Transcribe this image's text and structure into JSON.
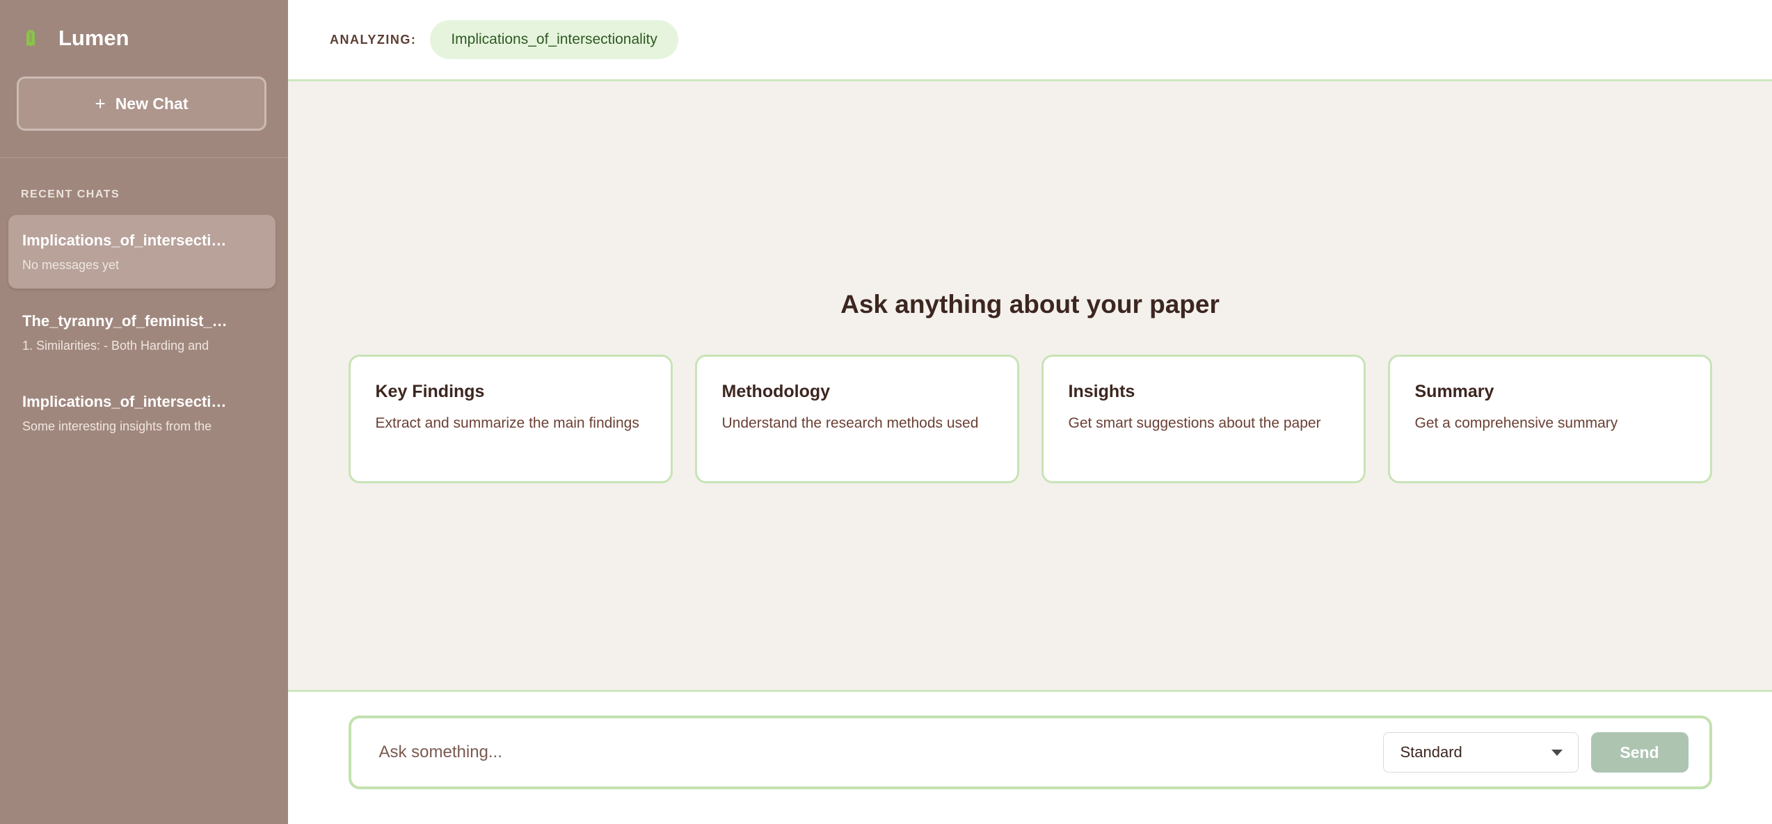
{
  "app": {
    "name": "Lumen",
    "icon": "lumen-logo-icon",
    "accent_color": "#8bc34a"
  },
  "sidebar": {
    "new_chat_icon": "+",
    "new_chat_label": "New Chat",
    "recent_label": "RECENT CHATS",
    "chats": [
      {
        "title": "Implications_of_intersectionality",
        "subtitle": "No messages yet",
        "active": true
      },
      {
        "title": "The_tyranny_of_feminist_theory",
        "subtitle": "1. Similarities: - Both Harding and",
        "active": false
      },
      {
        "title": "Implications_of_intersectionality",
        "subtitle": "Some interesting insights from the",
        "active": false
      }
    ]
  },
  "header": {
    "analyzing_label": "ANALYZING:",
    "document_name": "Implications_of_intersectionality"
  },
  "main": {
    "hero_title": "Ask anything about your paper",
    "cards": [
      {
        "title": "Key Findings",
        "description": "Extract and summarize the main findings"
      },
      {
        "title": "Methodology",
        "description": "Understand the research methods used"
      },
      {
        "title": "Insights",
        "description": "Get smart suggestions about the paper"
      },
      {
        "title": "Summary",
        "description": "Get a comprehensive summary"
      }
    ]
  },
  "composer": {
    "placeholder": "Ask something...",
    "mode_selected": "Standard",
    "send_label": "Send"
  }
}
